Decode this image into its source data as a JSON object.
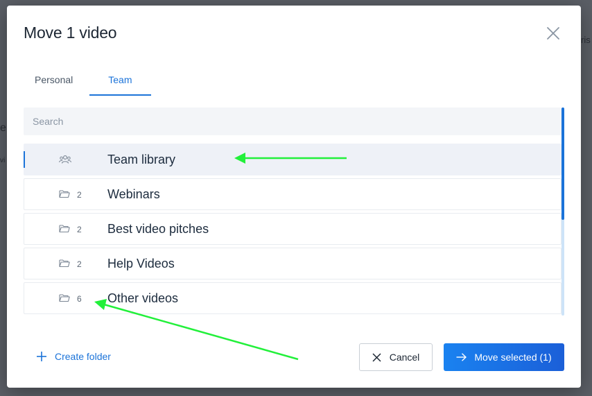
{
  "backdrop": {
    "fragment_right": "ris",
    "fragment_left_1": "e",
    "fragment_left_2": "vi"
  },
  "dialog": {
    "title": "Move 1 video",
    "close_icon": "close-icon"
  },
  "tabs": [
    {
      "label": "Personal",
      "active": false
    },
    {
      "label": "Team",
      "active": true
    }
  ],
  "search": {
    "placeholder": "Search",
    "value": ""
  },
  "folders": [
    {
      "icon": "team-icon",
      "count": "",
      "name": "Team library",
      "selected": true
    },
    {
      "icon": "folder-icon",
      "count": "2",
      "name": "Webinars",
      "selected": false
    },
    {
      "icon": "folder-icon",
      "count": "2",
      "name": "Best video pitches",
      "selected": false
    },
    {
      "icon": "folder-icon",
      "count": "2",
      "name": "Help Videos",
      "selected": false
    },
    {
      "icon": "folder-icon",
      "count": "6",
      "name": "Other videos",
      "selected": false
    }
  ],
  "footer": {
    "create_folder_label": "Create folder",
    "cancel_label": "Cancel",
    "move_label": "Move selected (1)"
  },
  "colors": {
    "accent": "#1b73d9",
    "annotation_arrow": "#22f03a"
  }
}
